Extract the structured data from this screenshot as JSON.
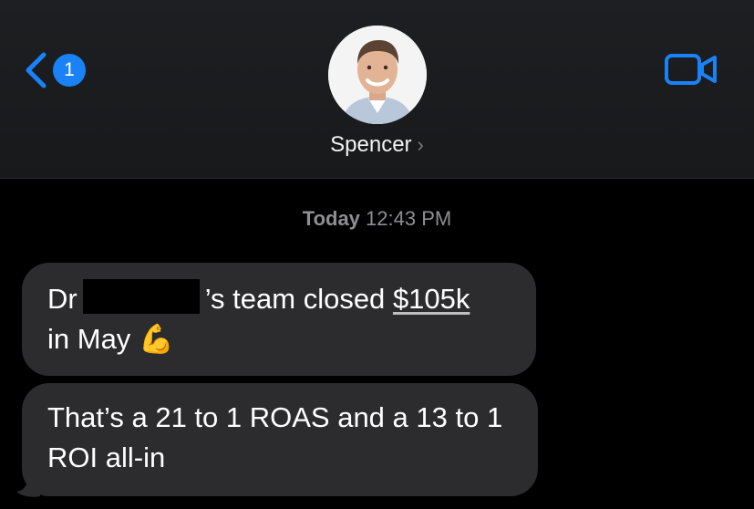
{
  "header": {
    "unread_count": "1",
    "contact_name": "Spencer",
    "contact_chevron": "›",
    "back_icon": "chevron-left-icon",
    "video_icon": "video-camera-icon"
  },
  "conversation": {
    "timestamp_day": "Today",
    "timestamp_time": "12:43 PM",
    "messages": [
      {
        "prefix": "Dr",
        "suffix": "’s team closed",
        "amount": "$105k",
        "line2": "in May",
        "emoji": "💪"
      },
      {
        "text": "That’s a 21 to 1 ROAS and a 13 to 1 ROI all-in"
      }
    ]
  },
  "colors": {
    "accent": "#1a82f7",
    "bubble": "#2c2c2e",
    "background": "#000000"
  }
}
